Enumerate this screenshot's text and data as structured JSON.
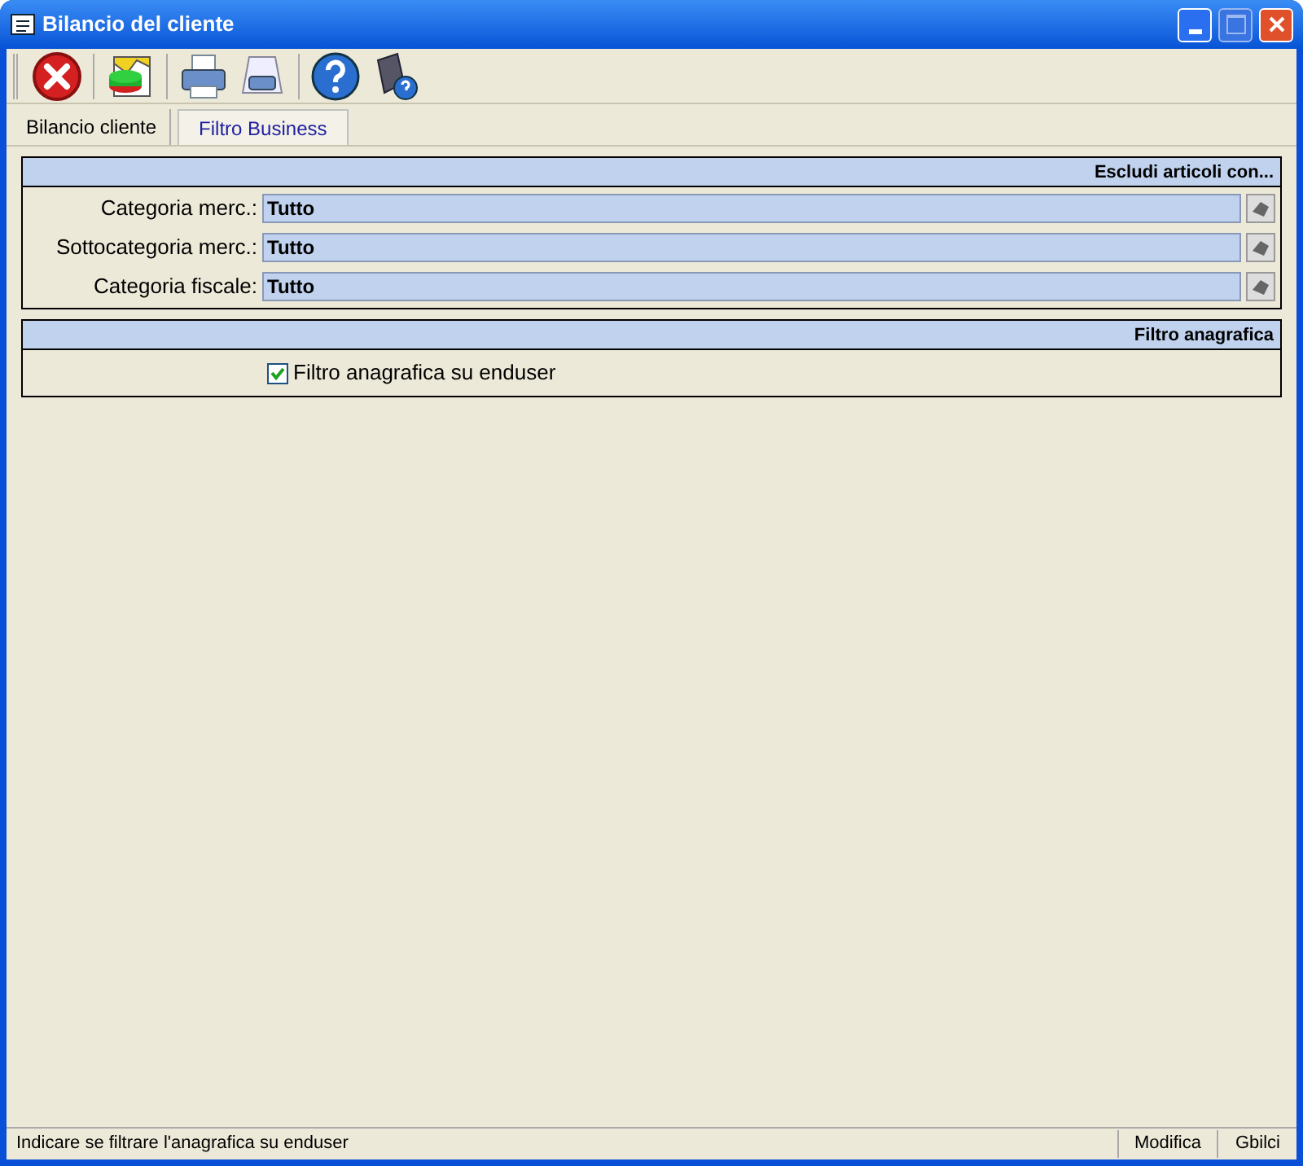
{
  "window": {
    "title": "Bilancio del cliente"
  },
  "tabs": [
    {
      "label": "Bilancio cliente",
      "selected": false
    },
    {
      "label": "Filtro Business",
      "selected": true
    }
  ],
  "sections": [
    {
      "title": "Escludi articoli con...",
      "kind": "fields",
      "fields": [
        {
          "label": "Categoria merc.:",
          "value": "Tutto"
        },
        {
          "label": "Sottocategoria merc.:",
          "value": "Tutto"
        },
        {
          "label": "Categoria fiscale:",
          "value": "Tutto"
        }
      ]
    },
    {
      "title": "Filtro anagrafica",
      "kind": "checkbox",
      "checkbox": {
        "label": "Filtro anagrafica su enduser",
        "checked": true
      }
    }
  ],
  "status_bar": {
    "message": "Indicare se filtrare l'anagrafica su enduser",
    "mode": "Modifica",
    "user": "Gbilci"
  }
}
